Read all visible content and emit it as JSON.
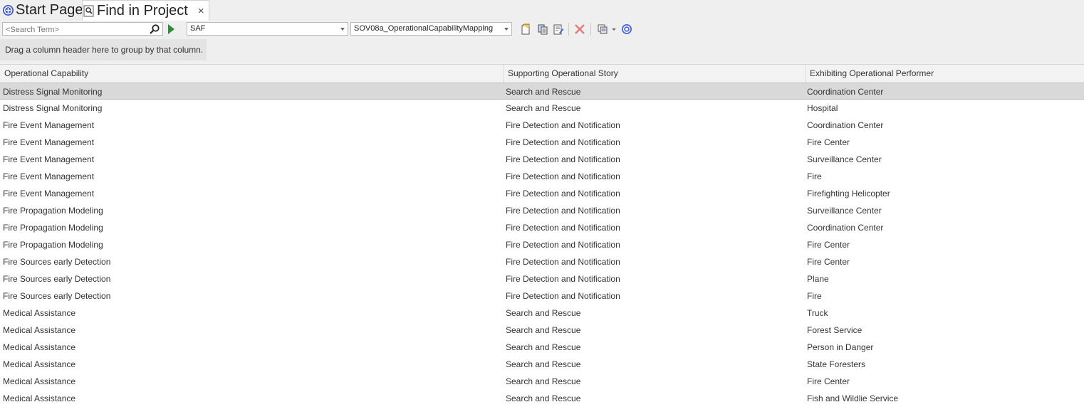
{
  "tabs": {
    "start_page": "Start Page",
    "find_in_project": "Find in Project",
    "close_symbol": "×"
  },
  "toolbar": {
    "search_placeholder": "<Search Term>",
    "search_icon": "magnifier-icon",
    "run_icon": "run-search-icon",
    "category_value": "SAF",
    "search_value": "SOV08a_OperationalCapabilityMapping",
    "icons": [
      "new-search-icon",
      "copy-search-icon",
      "edit-search-icon",
      "delete-search-icon",
      "view-options-icon",
      "help-icon"
    ]
  },
  "group_hint": "Drag a column header here to group by that column.",
  "columns": [
    "Operational Capability",
    "Supporting Operational Story",
    "Exhibiting Operational Performer"
  ],
  "rows": [
    [
      "Distress Signal Monitoring",
      "Search and Rescue",
      "Coordination Center"
    ],
    [
      "Distress Signal Monitoring",
      "Search and Rescue",
      "Hospital"
    ],
    [
      "Fire Event Management",
      "Fire Detection and Notification",
      "Coordination Center"
    ],
    [
      "Fire Event Management",
      "Fire Detection and Notification",
      "Fire Center"
    ],
    [
      "Fire Event Management",
      "Fire Detection and Notification",
      "Surveillance Center"
    ],
    [
      "Fire Event Management",
      "Fire Detection and Notification",
      "Fire"
    ],
    [
      "Fire Event Management",
      "Fire Detection and Notification",
      "Firefighting Helicopter"
    ],
    [
      "Fire Propagation Modeling",
      "Fire Detection and Notification",
      "Surveillance Center"
    ],
    [
      "Fire Propagation Modeling",
      "Fire Detection and Notification",
      "Coordination Center"
    ],
    [
      "Fire Propagation Modeling",
      "Fire Detection and Notification",
      "Fire Center"
    ],
    [
      "Fire Sources early Detection",
      "Fire Detection and Notification",
      "Fire Center"
    ],
    [
      "Fire Sources early Detection",
      "Fire Detection and Notification",
      "Plane"
    ],
    [
      "Fire Sources early Detection",
      "Fire Detection and Notification",
      "Fire"
    ],
    [
      "Medical Assistance",
      "Search and Rescue",
      "Truck"
    ],
    [
      "Medical Assistance",
      "Search and Rescue",
      "Forest Service"
    ],
    [
      "Medical Assistance",
      "Search and Rescue",
      "Person in Danger"
    ],
    [
      "Medical Assistance",
      "Search and Rescue",
      "State Foresters"
    ],
    [
      "Medical Assistance",
      "Search and Rescue",
      "Fire Center"
    ],
    [
      "Medical Assistance",
      "Search and Rescue",
      "Fish and Wildlie Service"
    ]
  ],
  "selected_row": 0
}
